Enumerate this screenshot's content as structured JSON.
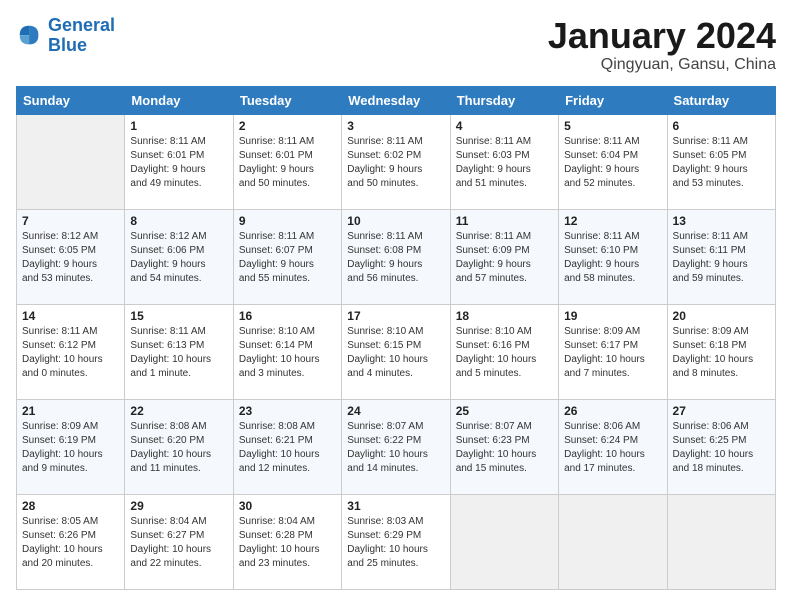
{
  "header": {
    "logo_line1": "General",
    "logo_line2": "Blue",
    "title": "January 2024",
    "location": "Qingyuan, Gansu, China"
  },
  "days_of_week": [
    "Sunday",
    "Monday",
    "Tuesday",
    "Wednesday",
    "Thursday",
    "Friday",
    "Saturday"
  ],
  "weeks": [
    [
      {
        "day": "",
        "info": ""
      },
      {
        "day": "1",
        "info": "Sunrise: 8:11 AM\nSunset: 6:01 PM\nDaylight: 9 hours\nand 49 minutes."
      },
      {
        "day": "2",
        "info": "Sunrise: 8:11 AM\nSunset: 6:01 PM\nDaylight: 9 hours\nand 50 minutes."
      },
      {
        "day": "3",
        "info": "Sunrise: 8:11 AM\nSunset: 6:02 PM\nDaylight: 9 hours\nand 50 minutes."
      },
      {
        "day": "4",
        "info": "Sunrise: 8:11 AM\nSunset: 6:03 PM\nDaylight: 9 hours\nand 51 minutes."
      },
      {
        "day": "5",
        "info": "Sunrise: 8:11 AM\nSunset: 6:04 PM\nDaylight: 9 hours\nand 52 minutes."
      },
      {
        "day": "6",
        "info": "Sunrise: 8:11 AM\nSunset: 6:05 PM\nDaylight: 9 hours\nand 53 minutes."
      }
    ],
    [
      {
        "day": "7",
        "info": "Sunrise: 8:12 AM\nSunset: 6:05 PM\nDaylight: 9 hours\nand 53 minutes."
      },
      {
        "day": "8",
        "info": "Sunrise: 8:12 AM\nSunset: 6:06 PM\nDaylight: 9 hours\nand 54 minutes."
      },
      {
        "day": "9",
        "info": "Sunrise: 8:11 AM\nSunset: 6:07 PM\nDaylight: 9 hours\nand 55 minutes."
      },
      {
        "day": "10",
        "info": "Sunrise: 8:11 AM\nSunset: 6:08 PM\nDaylight: 9 hours\nand 56 minutes."
      },
      {
        "day": "11",
        "info": "Sunrise: 8:11 AM\nSunset: 6:09 PM\nDaylight: 9 hours\nand 57 minutes."
      },
      {
        "day": "12",
        "info": "Sunrise: 8:11 AM\nSunset: 6:10 PM\nDaylight: 9 hours\nand 58 minutes."
      },
      {
        "day": "13",
        "info": "Sunrise: 8:11 AM\nSunset: 6:11 PM\nDaylight: 9 hours\nand 59 minutes."
      }
    ],
    [
      {
        "day": "14",
        "info": "Sunrise: 8:11 AM\nSunset: 6:12 PM\nDaylight: 10 hours\nand 0 minutes."
      },
      {
        "day": "15",
        "info": "Sunrise: 8:11 AM\nSunset: 6:13 PM\nDaylight: 10 hours\nand 1 minute."
      },
      {
        "day": "16",
        "info": "Sunrise: 8:10 AM\nSunset: 6:14 PM\nDaylight: 10 hours\nand 3 minutes."
      },
      {
        "day": "17",
        "info": "Sunrise: 8:10 AM\nSunset: 6:15 PM\nDaylight: 10 hours\nand 4 minutes."
      },
      {
        "day": "18",
        "info": "Sunrise: 8:10 AM\nSunset: 6:16 PM\nDaylight: 10 hours\nand 5 minutes."
      },
      {
        "day": "19",
        "info": "Sunrise: 8:09 AM\nSunset: 6:17 PM\nDaylight: 10 hours\nand 7 minutes."
      },
      {
        "day": "20",
        "info": "Sunrise: 8:09 AM\nSunset: 6:18 PM\nDaylight: 10 hours\nand 8 minutes."
      }
    ],
    [
      {
        "day": "21",
        "info": "Sunrise: 8:09 AM\nSunset: 6:19 PM\nDaylight: 10 hours\nand 9 minutes."
      },
      {
        "day": "22",
        "info": "Sunrise: 8:08 AM\nSunset: 6:20 PM\nDaylight: 10 hours\nand 11 minutes."
      },
      {
        "day": "23",
        "info": "Sunrise: 8:08 AM\nSunset: 6:21 PM\nDaylight: 10 hours\nand 12 minutes."
      },
      {
        "day": "24",
        "info": "Sunrise: 8:07 AM\nSunset: 6:22 PM\nDaylight: 10 hours\nand 14 minutes."
      },
      {
        "day": "25",
        "info": "Sunrise: 8:07 AM\nSunset: 6:23 PM\nDaylight: 10 hours\nand 15 minutes."
      },
      {
        "day": "26",
        "info": "Sunrise: 8:06 AM\nSunset: 6:24 PM\nDaylight: 10 hours\nand 17 minutes."
      },
      {
        "day": "27",
        "info": "Sunrise: 8:06 AM\nSunset: 6:25 PM\nDaylight: 10 hours\nand 18 minutes."
      }
    ],
    [
      {
        "day": "28",
        "info": "Sunrise: 8:05 AM\nSunset: 6:26 PM\nDaylight: 10 hours\nand 20 minutes."
      },
      {
        "day": "29",
        "info": "Sunrise: 8:04 AM\nSunset: 6:27 PM\nDaylight: 10 hours\nand 22 minutes."
      },
      {
        "day": "30",
        "info": "Sunrise: 8:04 AM\nSunset: 6:28 PM\nDaylight: 10 hours\nand 23 minutes."
      },
      {
        "day": "31",
        "info": "Sunrise: 8:03 AM\nSunset: 6:29 PM\nDaylight: 10 hours\nand 25 minutes."
      },
      {
        "day": "",
        "info": ""
      },
      {
        "day": "",
        "info": ""
      },
      {
        "day": "",
        "info": ""
      }
    ]
  ]
}
